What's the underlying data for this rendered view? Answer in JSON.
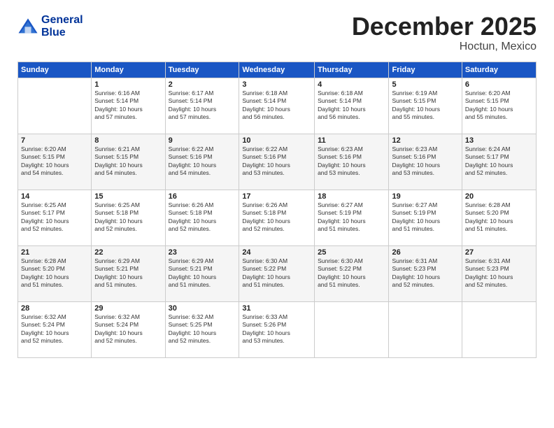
{
  "header": {
    "logo_line1": "General",
    "logo_line2": "Blue",
    "month": "December 2025",
    "location": "Hoctun, Mexico"
  },
  "days_of_week": [
    "Sunday",
    "Monday",
    "Tuesday",
    "Wednesday",
    "Thursday",
    "Friday",
    "Saturday"
  ],
  "weeks": [
    [
      {
        "day": "",
        "info": ""
      },
      {
        "day": "1",
        "info": "Sunrise: 6:16 AM\nSunset: 5:14 PM\nDaylight: 10 hours\nand 57 minutes."
      },
      {
        "day": "2",
        "info": "Sunrise: 6:17 AM\nSunset: 5:14 PM\nDaylight: 10 hours\nand 57 minutes."
      },
      {
        "day": "3",
        "info": "Sunrise: 6:18 AM\nSunset: 5:14 PM\nDaylight: 10 hours\nand 56 minutes."
      },
      {
        "day": "4",
        "info": "Sunrise: 6:18 AM\nSunset: 5:14 PM\nDaylight: 10 hours\nand 56 minutes."
      },
      {
        "day": "5",
        "info": "Sunrise: 6:19 AM\nSunset: 5:15 PM\nDaylight: 10 hours\nand 55 minutes."
      },
      {
        "day": "6",
        "info": "Sunrise: 6:20 AM\nSunset: 5:15 PM\nDaylight: 10 hours\nand 55 minutes."
      }
    ],
    [
      {
        "day": "7",
        "info": "Sunrise: 6:20 AM\nSunset: 5:15 PM\nDaylight: 10 hours\nand 54 minutes."
      },
      {
        "day": "8",
        "info": "Sunrise: 6:21 AM\nSunset: 5:15 PM\nDaylight: 10 hours\nand 54 minutes."
      },
      {
        "day": "9",
        "info": "Sunrise: 6:22 AM\nSunset: 5:16 PM\nDaylight: 10 hours\nand 54 minutes."
      },
      {
        "day": "10",
        "info": "Sunrise: 6:22 AM\nSunset: 5:16 PM\nDaylight: 10 hours\nand 53 minutes."
      },
      {
        "day": "11",
        "info": "Sunrise: 6:23 AM\nSunset: 5:16 PM\nDaylight: 10 hours\nand 53 minutes."
      },
      {
        "day": "12",
        "info": "Sunrise: 6:23 AM\nSunset: 5:16 PM\nDaylight: 10 hours\nand 53 minutes."
      },
      {
        "day": "13",
        "info": "Sunrise: 6:24 AM\nSunset: 5:17 PM\nDaylight: 10 hours\nand 52 minutes."
      }
    ],
    [
      {
        "day": "14",
        "info": "Sunrise: 6:25 AM\nSunset: 5:17 PM\nDaylight: 10 hours\nand 52 minutes."
      },
      {
        "day": "15",
        "info": "Sunrise: 6:25 AM\nSunset: 5:18 PM\nDaylight: 10 hours\nand 52 minutes."
      },
      {
        "day": "16",
        "info": "Sunrise: 6:26 AM\nSunset: 5:18 PM\nDaylight: 10 hours\nand 52 minutes."
      },
      {
        "day": "17",
        "info": "Sunrise: 6:26 AM\nSunset: 5:18 PM\nDaylight: 10 hours\nand 52 minutes."
      },
      {
        "day": "18",
        "info": "Sunrise: 6:27 AM\nSunset: 5:19 PM\nDaylight: 10 hours\nand 51 minutes."
      },
      {
        "day": "19",
        "info": "Sunrise: 6:27 AM\nSunset: 5:19 PM\nDaylight: 10 hours\nand 51 minutes."
      },
      {
        "day": "20",
        "info": "Sunrise: 6:28 AM\nSunset: 5:20 PM\nDaylight: 10 hours\nand 51 minutes."
      }
    ],
    [
      {
        "day": "21",
        "info": "Sunrise: 6:28 AM\nSunset: 5:20 PM\nDaylight: 10 hours\nand 51 minutes."
      },
      {
        "day": "22",
        "info": "Sunrise: 6:29 AM\nSunset: 5:21 PM\nDaylight: 10 hours\nand 51 minutes."
      },
      {
        "day": "23",
        "info": "Sunrise: 6:29 AM\nSunset: 5:21 PM\nDaylight: 10 hours\nand 51 minutes."
      },
      {
        "day": "24",
        "info": "Sunrise: 6:30 AM\nSunset: 5:22 PM\nDaylight: 10 hours\nand 51 minutes."
      },
      {
        "day": "25",
        "info": "Sunrise: 6:30 AM\nSunset: 5:22 PM\nDaylight: 10 hours\nand 51 minutes."
      },
      {
        "day": "26",
        "info": "Sunrise: 6:31 AM\nSunset: 5:23 PM\nDaylight: 10 hours\nand 52 minutes."
      },
      {
        "day": "27",
        "info": "Sunrise: 6:31 AM\nSunset: 5:23 PM\nDaylight: 10 hours\nand 52 minutes."
      }
    ],
    [
      {
        "day": "28",
        "info": "Sunrise: 6:32 AM\nSunset: 5:24 PM\nDaylight: 10 hours\nand 52 minutes."
      },
      {
        "day": "29",
        "info": "Sunrise: 6:32 AM\nSunset: 5:24 PM\nDaylight: 10 hours\nand 52 minutes."
      },
      {
        "day": "30",
        "info": "Sunrise: 6:32 AM\nSunset: 5:25 PM\nDaylight: 10 hours\nand 52 minutes."
      },
      {
        "day": "31",
        "info": "Sunrise: 6:33 AM\nSunset: 5:26 PM\nDaylight: 10 hours\nand 53 minutes."
      },
      {
        "day": "",
        "info": ""
      },
      {
        "day": "",
        "info": ""
      },
      {
        "day": "",
        "info": ""
      }
    ]
  ]
}
